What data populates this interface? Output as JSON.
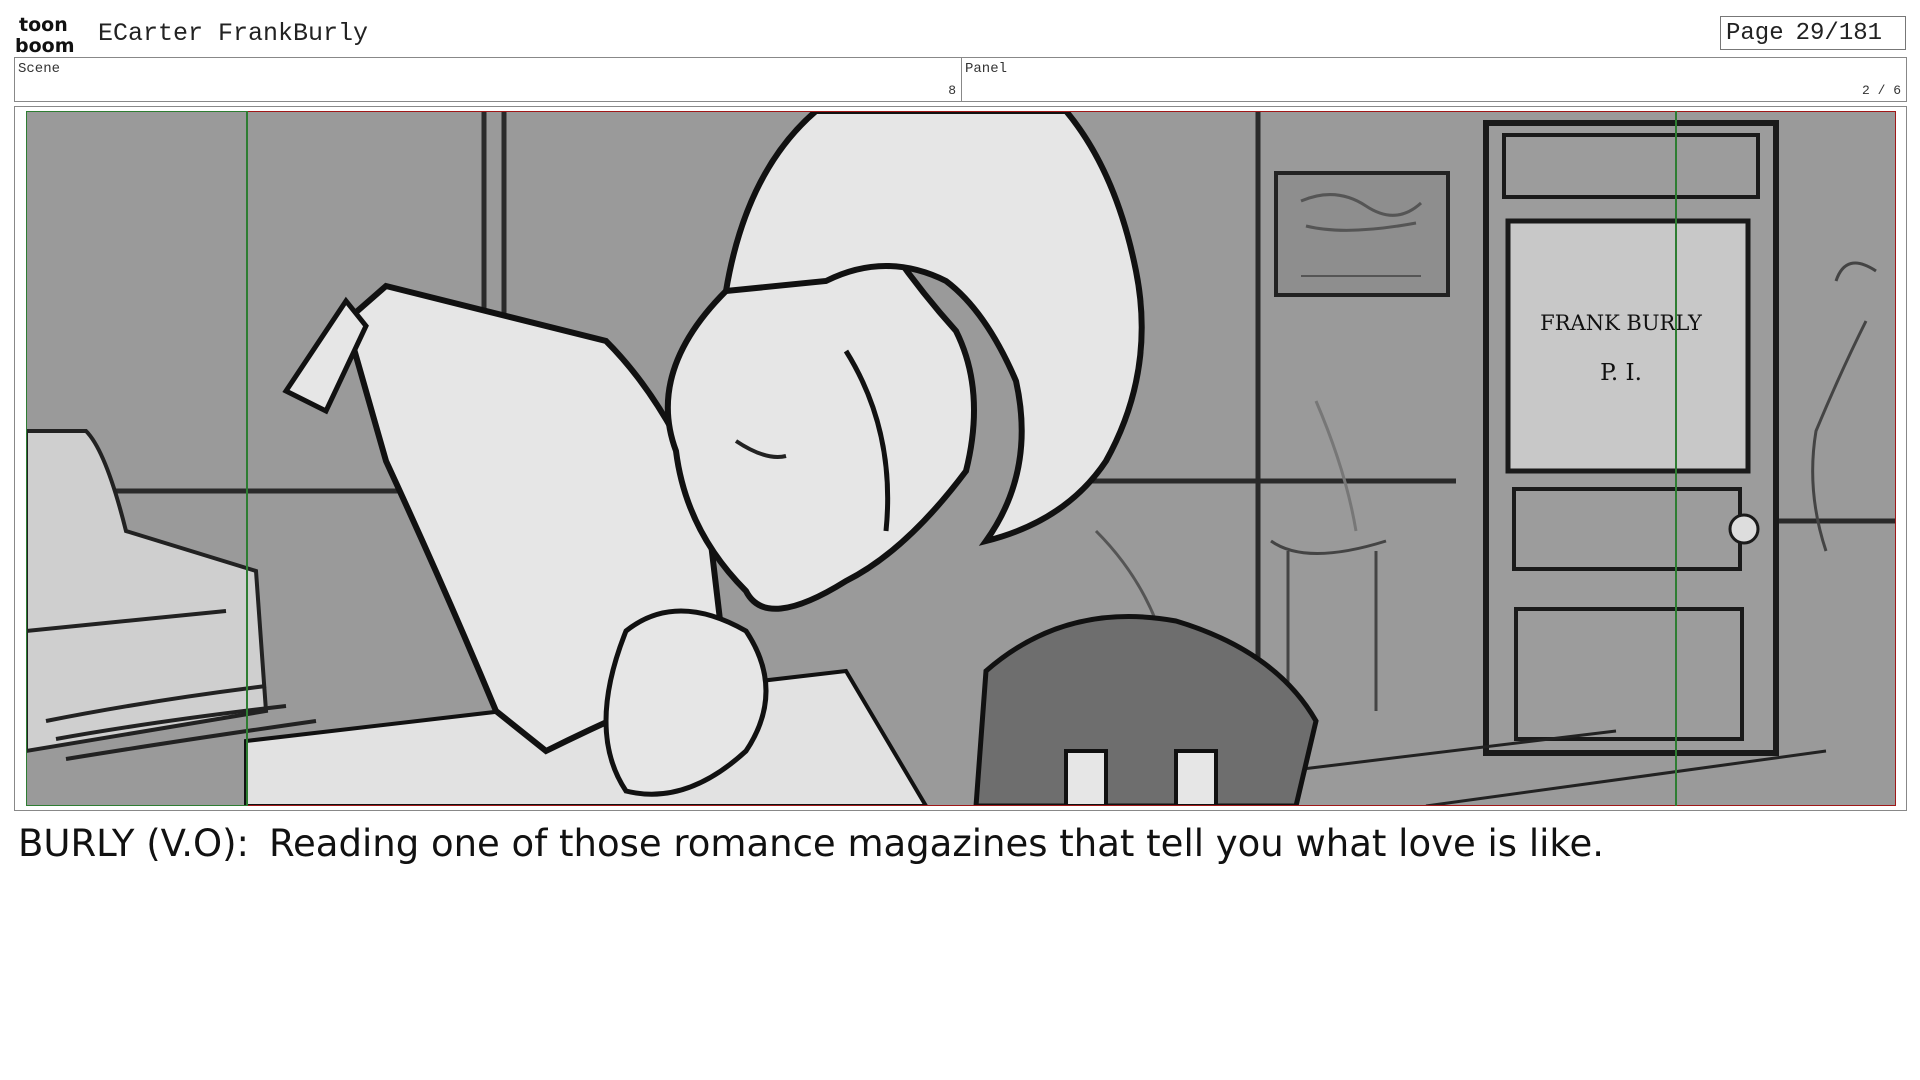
{
  "header": {
    "logo_text_top": "toon",
    "logo_text_bottom": "boom",
    "project_title": "ECarter FrankBurly",
    "page_label": "Page",
    "page_number": "29/181"
  },
  "info": {
    "scene_label": "Scene",
    "scene_value": "8",
    "panel_label": "Panel",
    "panel_value": "2 / 6"
  },
  "panel_image": {
    "door_sign_line1": "FRANK BURLY",
    "door_sign_line2": "P. I.",
    "colors": {
      "safe_frame_red": "#a01818",
      "camera_frame_green": "#2e7d32",
      "background_gray": "#9a9a9a",
      "light_gray": "#e4e4e4"
    }
  },
  "dialogue": {
    "speaker": "BURLY (V.O):",
    "text": "Reading one of those romance magazines that tell you what love is like."
  }
}
